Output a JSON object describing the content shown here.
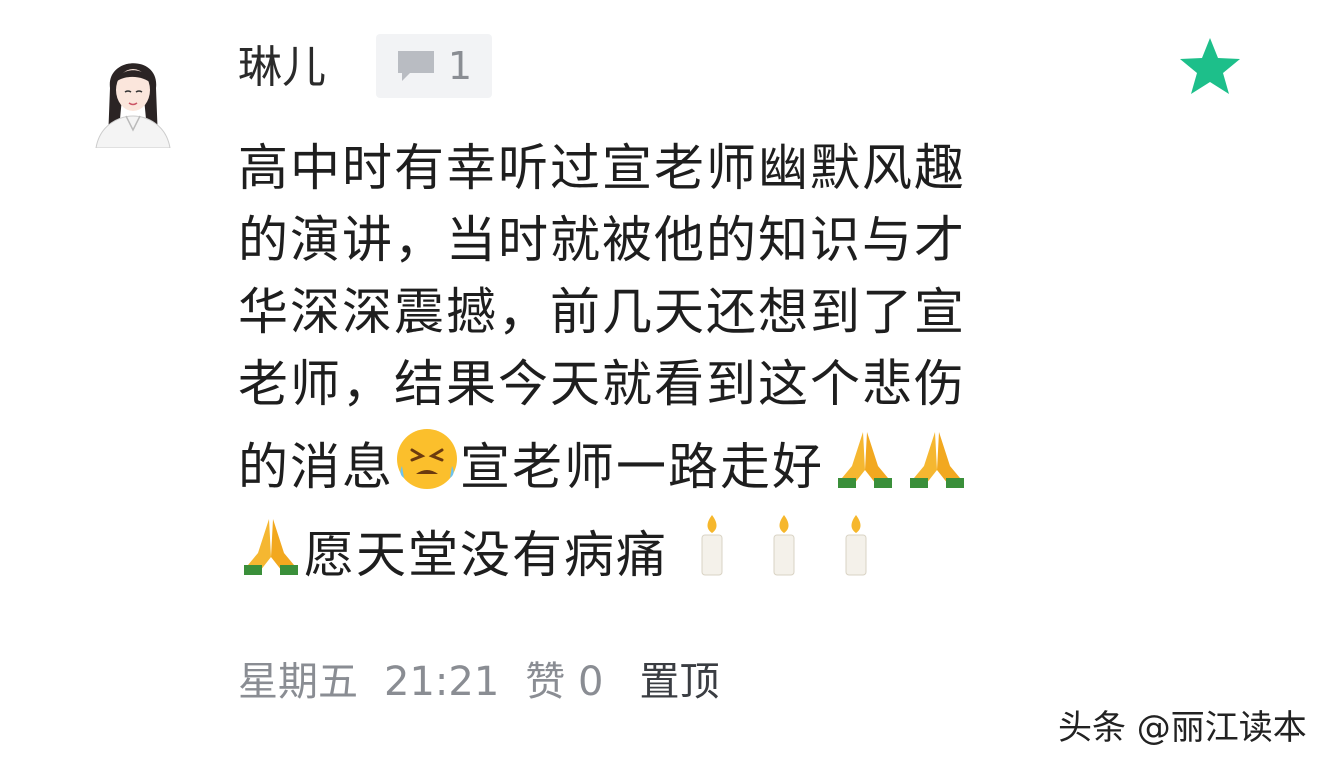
{
  "comment": {
    "user_name": "琳儿",
    "reply_count": "1",
    "lines": [
      "高中时有幸听过宣老师幽默风趣",
      "的演讲，当时就被他的知识与才",
      "华深深震撼，前几天还想到了宣",
      "老师，结果今天就看到这个悲伤"
    ],
    "line5_before": "的消息",
    "line5_after": "宣老师一路走好",
    "line6_text": "愿天堂没有病痛"
  },
  "meta": {
    "day": "星期五",
    "time": "21:21",
    "like_text": "赞 0",
    "pin_label": "置顶"
  },
  "watermark": "头条 @丽江读本",
  "icons": {
    "avatar": "avatar-illustration",
    "reply": "comment-bubble-icon",
    "star": "star-icon",
    "emoji_sad": "persevering-face-emoji",
    "emoji_pray": "folded-hands-emoji",
    "emoji_candle": "candle-emoji"
  },
  "colors": {
    "star": "#1dbf8a",
    "meta_text": "#8a8d93",
    "badge_bg": "#f2f3f5"
  }
}
